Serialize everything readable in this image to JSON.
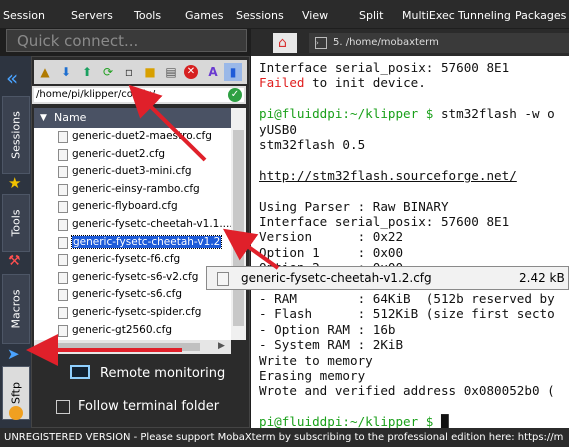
{
  "menubar": {
    "items": [
      "Session",
      "Servers",
      "Tools",
      "Games",
      "Sessions",
      "View",
      "Split",
      "MultiExec",
      "Tunneling",
      "Packages"
    ]
  },
  "quick_connect": {
    "placeholder": "Quick connect..."
  },
  "sidebar_tabs": {
    "sessions": "Sessions",
    "tools": "Tools",
    "macros": "Macros",
    "sftp": "Sftp"
  },
  "sftp": {
    "path": "/home/pi/klipper/config/",
    "column_name": "Name",
    "files": [
      "generic-duet2-maestro.cfg",
      "generic-duet2.cfg",
      "generic-duet3-mini.cfg",
      "generic-einsy-rambo.cfg",
      "generic-flyboard.cfg",
      "generic-fysetc-cheetah-v1.1.cfg",
      "generic-fysetc-cheetah-v1.2",
      "generic-fysetc-f6.cfg",
      "generic-fysetc-s6-v2.cfg",
      "generic-fysetc-s6.cfg",
      "generic-fysetc-spider.cfg",
      "generic-gt2560.cfg"
    ],
    "files_display": [
      "generic-duet2-maestro.cfg",
      "generic-duet2.cfg",
      "generic-duet3-mini.cfg",
      "generic-einsy-rambo.cfg",
      "generic-flyboard.cfg",
      "generic-fysetc-cheetah-v1.1....",
      "generic-fysetc-cheetah-v1.2",
      "generic-fysetc-f6.cfg",
      "generic-fysetc-s6-v2.cfg",
      "generic-fysetc-s6.cfg",
      "generic-fysetc-spider.cfg",
      "generic-gt2560.cfg"
    ],
    "selected_index": 6,
    "remote_monitoring": "Remote monitoring",
    "follow_terminal": "Follow terminal folder"
  },
  "tabs": {
    "active_label": "5. /home/mobaxterm"
  },
  "terminal": {
    "lines": [
      {
        "text": "Interface serial_posix: 57600 8E1",
        "color": "#111111"
      },
      {
        "text": "Failed to init device.",
        "color": "#111111",
        "accent": "Failed"
      },
      {
        "text": "",
        "color": "#111111"
      },
      {
        "text": "pi@fluiddpi:~/klipper $ stm32flash -w o",
        "color": "#111111",
        "prompt": "pi@fluiddpi:~/klipper $"
      },
      {
        "text": "yUSB0",
        "color": "#111111"
      },
      {
        "text": "stm32flash 0.5",
        "color": "#111111"
      },
      {
        "text": "",
        "color": "#111111"
      },
      {
        "text": "http://stm32flash.sourceforge.net/",
        "color": "#111111",
        "underline": true
      },
      {
        "text": "",
        "color": "#111111"
      },
      {
        "text": "Using Parser : Raw BINARY",
        "color": "#111111"
      },
      {
        "text": "Interface serial_posix: 57600 8E1",
        "color": "#111111"
      },
      {
        "text": "Version      : 0x22",
        "color": "#111111"
      },
      {
        "text": "Option 1     : 0x00",
        "color": "#111111"
      },
      {
        "text": "Option 2     : 0x00",
        "color": "#111111"
      },
      {
        "text": "",
        "color": "#111111"
      },
      {
        "text": "- RAM        : 64KiB  (512b reserved by",
        "color": "#111111"
      },
      {
        "text": "- Flash      : 512KiB (size first secto",
        "color": "#111111"
      },
      {
        "text": "- Option RAM : 16b",
        "color": "#111111"
      },
      {
        "text": "- System RAM : 2KiB",
        "color": "#111111"
      },
      {
        "text": "Write to memory",
        "color": "#111111"
      },
      {
        "text": "Erasing memory",
        "color": "#111111"
      },
      {
        "text": "Wrote and verified address 0x080052b0 (",
        "color": "#111111"
      },
      {
        "text": "",
        "color": "#111111"
      },
      {
        "text": "pi@fluiddpi:~/klipper $ ",
        "color": "#111111",
        "prompt": "pi@fluiddpi:~/klipper $"
      }
    ]
  },
  "tooltip": {
    "filename": "generic-fysetc-cheetah-v1.2.cfg",
    "size": "2.42 kB"
  },
  "status": {
    "text": "UNREGISTERED VERSION  -  Please support MobaXterm by subscribing to the professional edition here:  https://m"
  },
  "colors": {
    "prompt": "#1aa01a",
    "failed": "#e02020",
    "arrow": "#e0202a",
    "selected": "#1e5bd8"
  }
}
